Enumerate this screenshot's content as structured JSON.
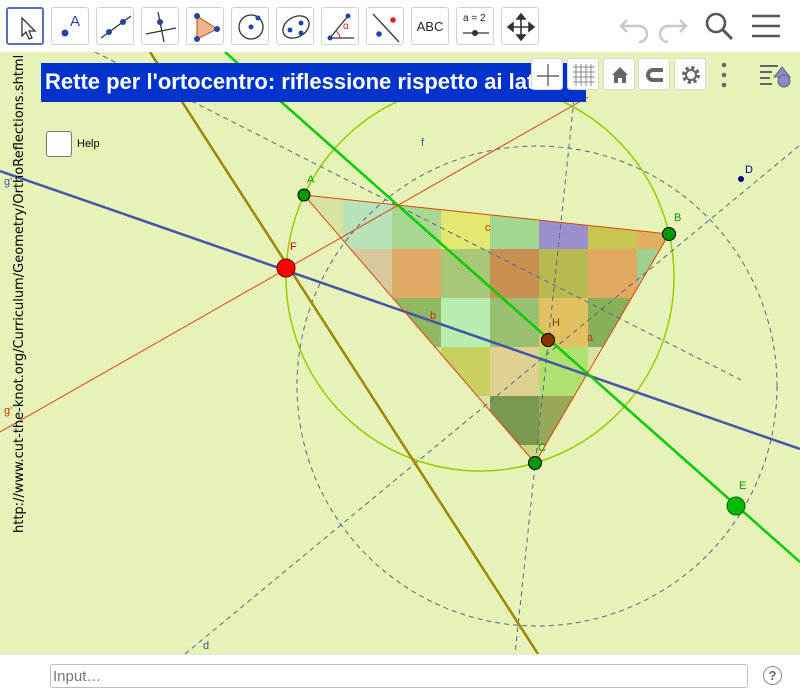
{
  "toolbar": {
    "tools": [
      {
        "name": "move-tool",
        "label": ""
      },
      {
        "name": "point-tool",
        "label": "A"
      },
      {
        "name": "line-tool",
        "label": ""
      },
      {
        "name": "perpendicular-line-tool",
        "label": ""
      },
      {
        "name": "polygon-tool",
        "label": ""
      },
      {
        "name": "circle-center-point-tool",
        "label": ""
      },
      {
        "name": "ellipse-tool",
        "label": ""
      },
      {
        "name": "angle-tool",
        "label": "α"
      },
      {
        "name": "reflect-tool",
        "label": ""
      },
      {
        "name": "text-tool",
        "label": "ABC"
      },
      {
        "name": "slider-tool",
        "label": "a = 2"
      },
      {
        "name": "move-graphics-view-tool",
        "label": ""
      }
    ]
  },
  "title": "Rette per l'ortocentro: riflessione rispetto ai lati",
  "help_label": "Help",
  "url_text": "http://www.cut-the-knot.org/Curriculum/Geometry/OrthoReflections.shtml",
  "labels": {
    "A": "A",
    "B": "B",
    "C": "C",
    "D": "D",
    "E": "E",
    "F": "F",
    "H": "H",
    "a": "a",
    "b": "b",
    "c": "c",
    "d": "d",
    "f": "f",
    "g1": "g'",
    "g2": "g'"
  },
  "input": {
    "placeholder": "Input…"
  },
  "colors": {
    "canvas_bg": "#e6f2b8",
    "title_bg": "#0033cc",
    "point_green": "#009900",
    "point_red": "#ff0000",
    "line_green": "#00cc00",
    "line_blue": "#4455aa",
    "line_olive": "#998800",
    "line_orange": "#dd4411",
    "circle": "#99cc00"
  }
}
